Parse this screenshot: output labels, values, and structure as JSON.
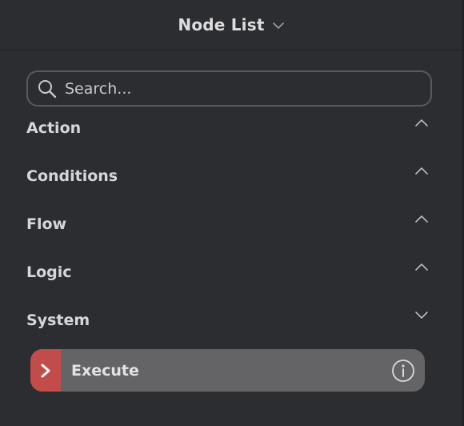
{
  "header": {
    "title": "Node List",
    "dropdown_icon": "chevron-down-icon"
  },
  "search": {
    "placeholder": "Search...",
    "value": "",
    "icon": "search-icon"
  },
  "categories": [
    {
      "label": "Action",
      "expanded": false,
      "icon": "chevron-up-icon"
    },
    {
      "label": "Conditions",
      "expanded": false,
      "icon": "chevron-up-icon"
    },
    {
      "label": "Flow",
      "expanded": false,
      "icon": "chevron-up-icon"
    },
    {
      "label": "Logic",
      "expanded": false,
      "icon": "chevron-up-icon"
    },
    {
      "label": "System",
      "expanded": true,
      "icon": "chevron-down-icon"
    }
  ],
  "nodes": [
    {
      "label": "Execute",
      "accent_color": "#c24c4a",
      "icon": "chevron-right-icon",
      "info_icon": "info-icon"
    }
  ],
  "colors": {
    "panel_bg": "#2c2d31",
    "text": "#d7d7da",
    "node_bg": "#646466",
    "node_accent": "#c24c4a"
  }
}
